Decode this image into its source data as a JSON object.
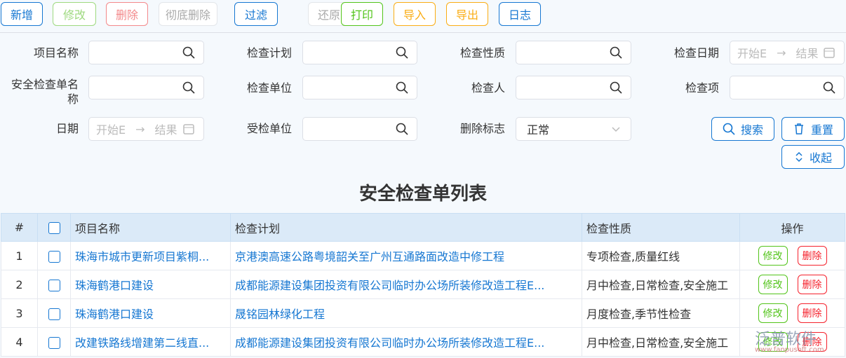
{
  "toolbar": [
    {
      "label": "新增",
      "color": "#1677d2"
    },
    {
      "label": "修改",
      "color": "#9ed97f"
    },
    {
      "label": "删除",
      "color": "#f3898b"
    },
    {
      "label": "彻底删除",
      "color": "#aaaaaa"
    },
    {
      "label": "过滤",
      "color": "#1677d2"
    },
    {
      "label": "还原",
      "color": "#aaaaaa"
    },
    {
      "label": "打印",
      "color": "#52c41a"
    },
    {
      "label": "导入",
      "color": "#faad14"
    },
    {
      "label": "导出",
      "color": "#faad14"
    },
    {
      "label": "日志",
      "color": "#1677d2"
    }
  ],
  "filters": {
    "project_name": "项目名称",
    "plan": "检查计划",
    "nature": "检查性质",
    "check_date": "检查日期",
    "sheet_name": "安全检查单名称",
    "unit": "检查单位",
    "inspector": "检查人",
    "item": "检查项",
    "date": "日期",
    "inspected_unit": "受检单位",
    "delete_flag": "删除标志",
    "delete_flag_value": "正常",
    "start_ph": "开始E",
    "end_ph": "结果",
    "arrow": "→"
  },
  "buttons": {
    "search": "搜索",
    "reset": "重置",
    "collapse": "收起"
  },
  "table": {
    "title": "安全检查单列表",
    "headers": [
      "#",
      "",
      "项目名称",
      "检查计划",
      "检查性质",
      "操作"
    ],
    "edit": "修改",
    "delete": "删除",
    "rows": [
      {
        "no": "1",
        "project": "珠海市城市更新项目紫桐...",
        "plan": "京港澳高速公路粤境韶关至广州互通路面改造中修工程",
        "nature": "专项检查,质量红线"
      },
      {
        "no": "2",
        "project": "珠海鹤港口建设",
        "plan": "成都能源建设集团投资有限公司临时办公场所装修改造工程E...",
        "nature": "月中检查,日常检查,安全施工"
      },
      {
        "no": "3",
        "project": "珠海鹤港口建设",
        "plan": "晟铭园林绿化工程",
        "nature": "月度检查,季节性检查"
      },
      {
        "no": "4",
        "project": "改建铁路线增建第二线直...",
        "plan": "成都能源建设集团投资有限公司临时办公场所装修改造工程E...",
        "nature": "月中检查,日常检查,安全施工"
      }
    ]
  },
  "watermark": {
    "name": "泛普软件",
    "url": "www.fanpusoft.com"
  }
}
